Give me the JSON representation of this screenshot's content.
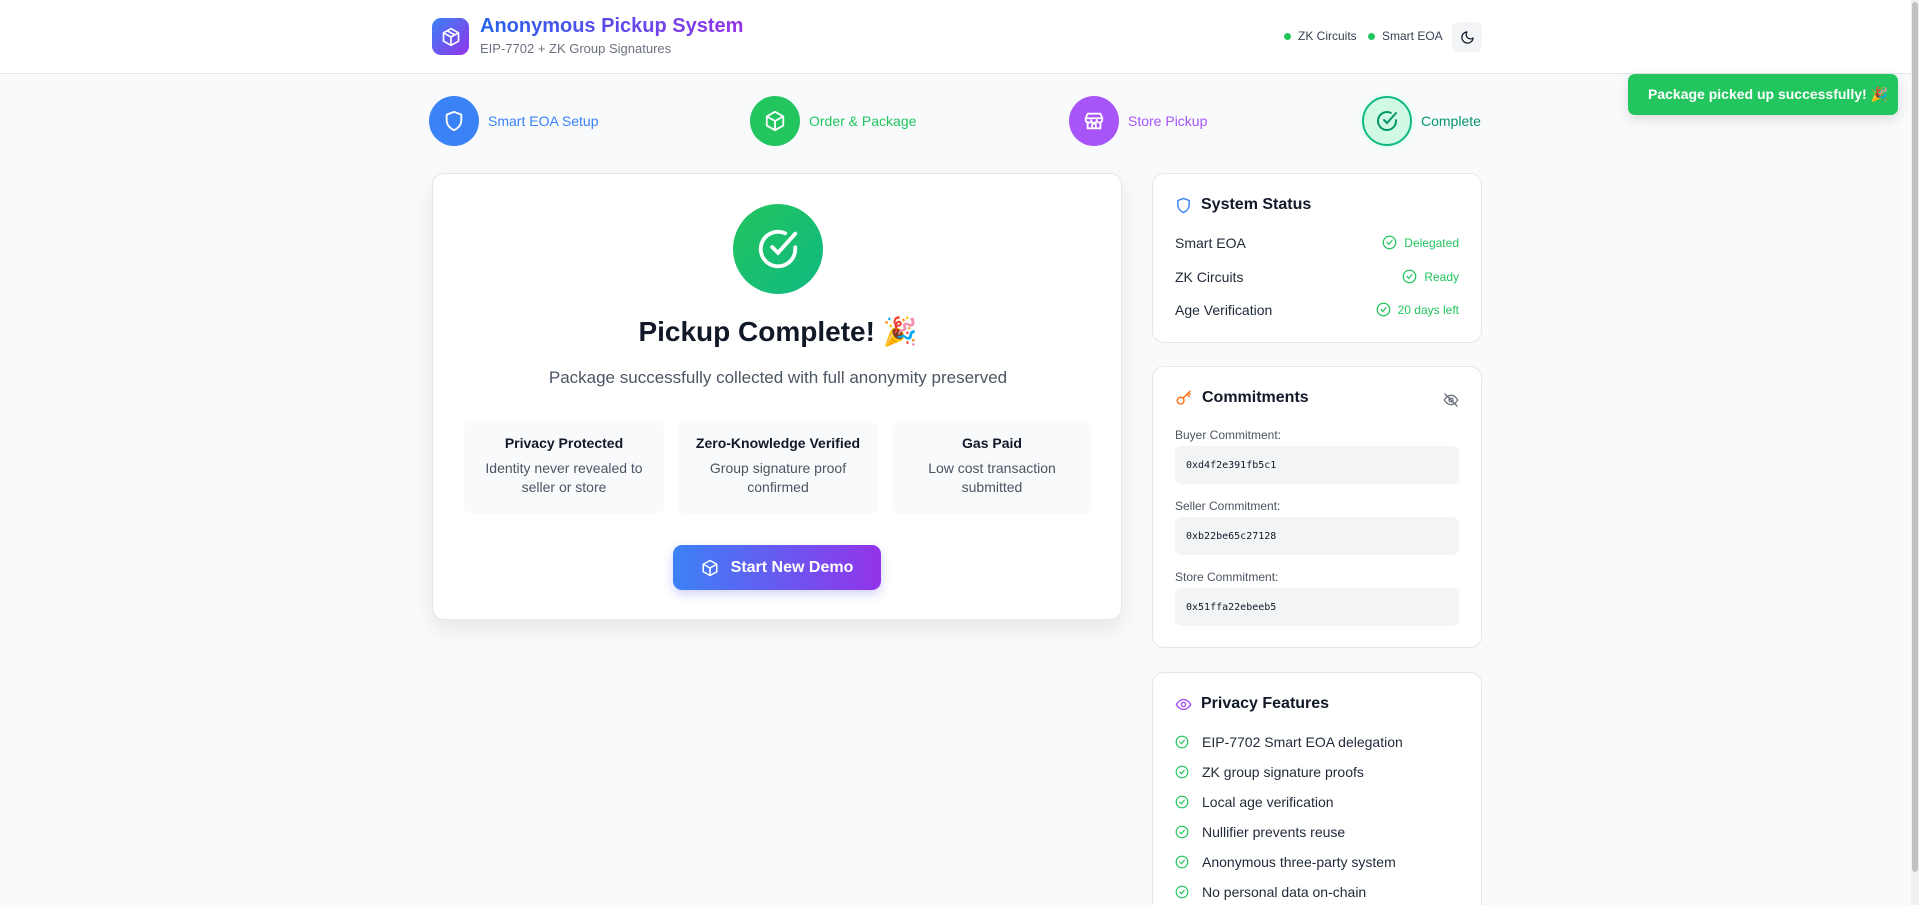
{
  "header": {
    "title": "Anonymous Pickup System",
    "subtitle": "EIP-7702 + ZK Group Signatures",
    "status": [
      "ZK Circuits",
      "Smart EOA"
    ]
  },
  "toast": {
    "message": "Package picked up successfully! 🎉"
  },
  "steps": [
    {
      "label": "Smart EOA Setup",
      "color": "#3b82f6",
      "icon": "shield-icon"
    },
    {
      "label": "Order & Package",
      "color": "#22c55e",
      "icon": "package-icon"
    },
    {
      "label": "Store Pickup",
      "color": "#a855f7",
      "icon": "store-icon"
    },
    {
      "label": "Complete",
      "color": "#059669",
      "icon": "check-circle-icon"
    }
  ],
  "main": {
    "title": "Pickup Complete! 🎉",
    "subtitle": "Package successfully collected with full anonymity preserved",
    "features": [
      {
        "title": "Privacy Protected",
        "desc": "Identity never revealed to seller or store"
      },
      {
        "title": "Zero-Knowledge Verified",
        "desc": "Group signature proof confirmed"
      },
      {
        "title": "Gas Paid",
        "desc": "Low cost transaction submitted"
      }
    ],
    "button": "Start New Demo"
  },
  "system_status": {
    "title": "System Status",
    "rows": [
      {
        "label": "Smart EOA",
        "value": "Delegated"
      },
      {
        "label": "ZK Circuits",
        "value": "Ready"
      },
      {
        "label": "Age Verification",
        "value": "20 days left"
      }
    ]
  },
  "commitments": {
    "title": "Commitments",
    "items": [
      {
        "label": "Buyer Commitment:",
        "value": "0xd4f2e391fb5c1"
      },
      {
        "label": "Seller Commitment:",
        "value": "0xb22be65c27128"
      },
      {
        "label": "Store Commitment:",
        "value": "0x51ffa22ebeeb5"
      }
    ]
  },
  "privacy": {
    "title": "Privacy Features",
    "items": [
      "EIP-7702 Smart EOA delegation",
      "ZK group signature proofs",
      "Local age verification",
      "Nullifier prevents reuse",
      "Anonymous three-party system",
      "No personal data on-chain"
    ]
  },
  "colors": {
    "accent_blue": "#3b82f6",
    "accent_purple": "#9333ea",
    "success": "#22c55e",
    "commit_key": "#f97316"
  }
}
